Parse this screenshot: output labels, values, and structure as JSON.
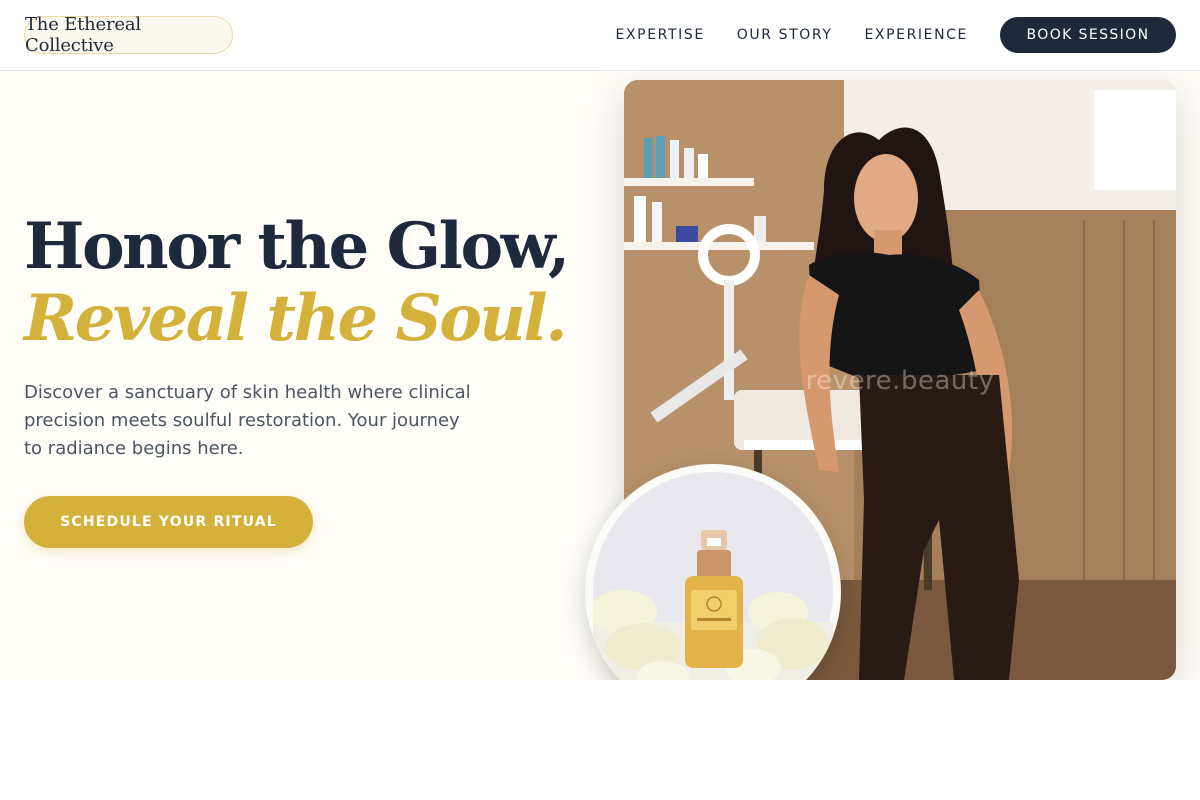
{
  "brand": {
    "name": "The Ethereal Collective"
  },
  "nav": {
    "links": [
      "EXPERTISE",
      "OUR STORY",
      "EXPERIENCE"
    ],
    "cta_label": "BOOK SESSION"
  },
  "hero": {
    "headline_line1": "Honor the Glow,",
    "headline_line2": "Reveal the Soul.",
    "intro": "Discover a sanctuary of skin health where clinical precision meets soulful restoration. Your journey to radiance begins here.",
    "cta_label": "SCHEDULE YOUR RITUAL"
  },
  "media": {
    "main_photo_watermark": "revere.beauty",
    "main_photo_subject": "esthetician-in-treatment-room",
    "inset_photo_subject": "serum-bottle-with-petals"
  },
  "colors": {
    "navy": "#1e2a3c",
    "gold": "#d4b13a",
    "cream": "#fffdf8",
    "body_text": "#4b5563"
  }
}
